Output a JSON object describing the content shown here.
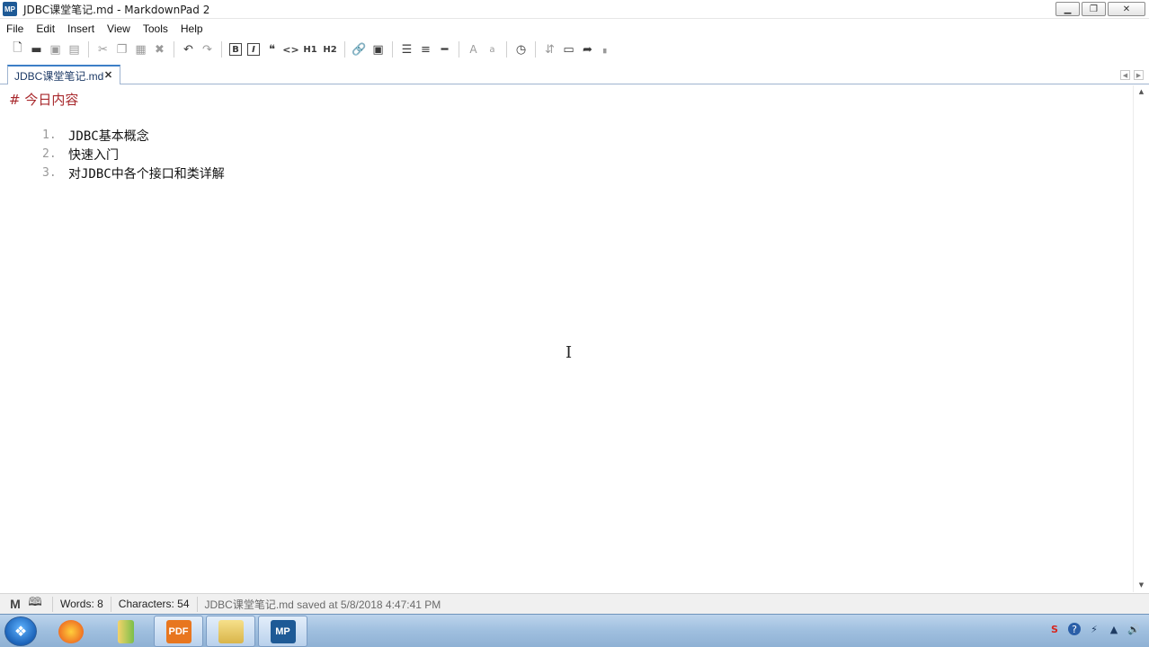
{
  "window": {
    "app_icon": "MP",
    "title": "JDBC课堂笔记.md - MarkdownPad 2",
    "minimize_icon": "minimize-icon",
    "maximize_icon": "maximize-icon",
    "close_icon": "close-icon"
  },
  "menu": {
    "items": [
      "File",
      "Edit",
      "Insert",
      "View",
      "Tools",
      "Help"
    ]
  },
  "toolbar": {
    "bold_label": "B",
    "italic_label": "I",
    "h1_label": "H1",
    "h2_label": "H2",
    "font_large_label": "A",
    "font_small_label": "a"
  },
  "tabs": [
    {
      "label": "JDBC课堂笔记.md",
      "active": true
    }
  ],
  "editor": {
    "heading": "# 今日内容",
    "list": [
      {
        "num": "1.",
        "text": "JDBC基本概念"
      },
      {
        "num": "2.",
        "text": "快速入门"
      },
      {
        "num": "3.",
        "text": "对JDBC中各个接口和类详解"
      }
    ]
  },
  "status": {
    "words": "Words: 8",
    "characters": "Characters: 54",
    "save_message": "JDBC课堂笔记.md saved at 5/8/2018 4:47:41 PM"
  },
  "taskbar": {
    "pinned": [
      "start-orb",
      "app-launcher",
      "paint-app",
      "pdf-app",
      "file-explorer",
      "markdownpad"
    ],
    "markdownpad_label": "MP",
    "pdf_label": "PDF"
  },
  "colors": {
    "heading": "#a8282c",
    "tab_accent": "#3c7fc7",
    "taskbar": "#9fbfdf"
  }
}
